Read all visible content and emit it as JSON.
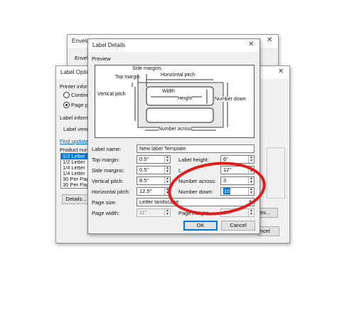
{
  "envelopes_window": {
    "title": "Envelop",
    "label": "Envelo"
  },
  "label_options_window": {
    "title": "Label Optio",
    "printer_info": "Printer inform",
    "radio_continuous": "Continu",
    "radio_page": "Page pr",
    "label_info": "Label inform",
    "label_vendor": "Label vend",
    "find_updates": "Find update",
    "product_number": "Product num",
    "products": [
      "1/2 Letter",
      "1/2 Letter",
      "1/4 Letter",
      "1/4 Letter",
      "30 Per Page",
      "30 Per Page"
    ],
    "details_button": "Details...",
    "ok_fragment": "es...",
    "cancel_button": "ncel"
  },
  "dialog": {
    "title": "Label Details",
    "preview_label": "Preview",
    "diagram": {
      "side_margins": "Side margins",
      "top_margin": "Top margin",
      "horizontal_pitch": "Horizontal pitch",
      "vertical_pitch": "Vertical pitch",
      "width": "Width",
      "height": "Height",
      "number_down": "Number down",
      "number_across": "Number across"
    },
    "label_name": {
      "label": "Label name:",
      "value": "New label Template"
    },
    "top_margin": {
      "label": "Top margin:",
      "value": "0.5\""
    },
    "side_margins": {
      "label": "Side margins:",
      "value": "0.5\""
    },
    "vertical_pitch": {
      "label": "Vertical pitch:",
      "value": "8.5\""
    },
    "horizontal_pitch": {
      "label": "Horizontal pitch:",
      "value": "12.5\""
    },
    "page_size": {
      "label": "Page size:",
      "value": "Letter landscape"
    },
    "page_width": {
      "label": "Page width:",
      "value": "11\""
    },
    "label_height": {
      "label": "Label height:",
      "value": "6\""
    },
    "label_width": {
      "label": "L",
      "value": "12\""
    },
    "number_across": {
      "label": "Number across:",
      "value": "3"
    },
    "number_down": {
      "label": "Number down:",
      "value": "10"
    },
    "page_height": {
      "label": "Page Height:",
      "value": "8.5\""
    },
    "ok_button": "OK",
    "cancel_button": "Cancel"
  },
  "colors": {
    "annotation": "#e21b1b",
    "accent": "#0078d7"
  }
}
